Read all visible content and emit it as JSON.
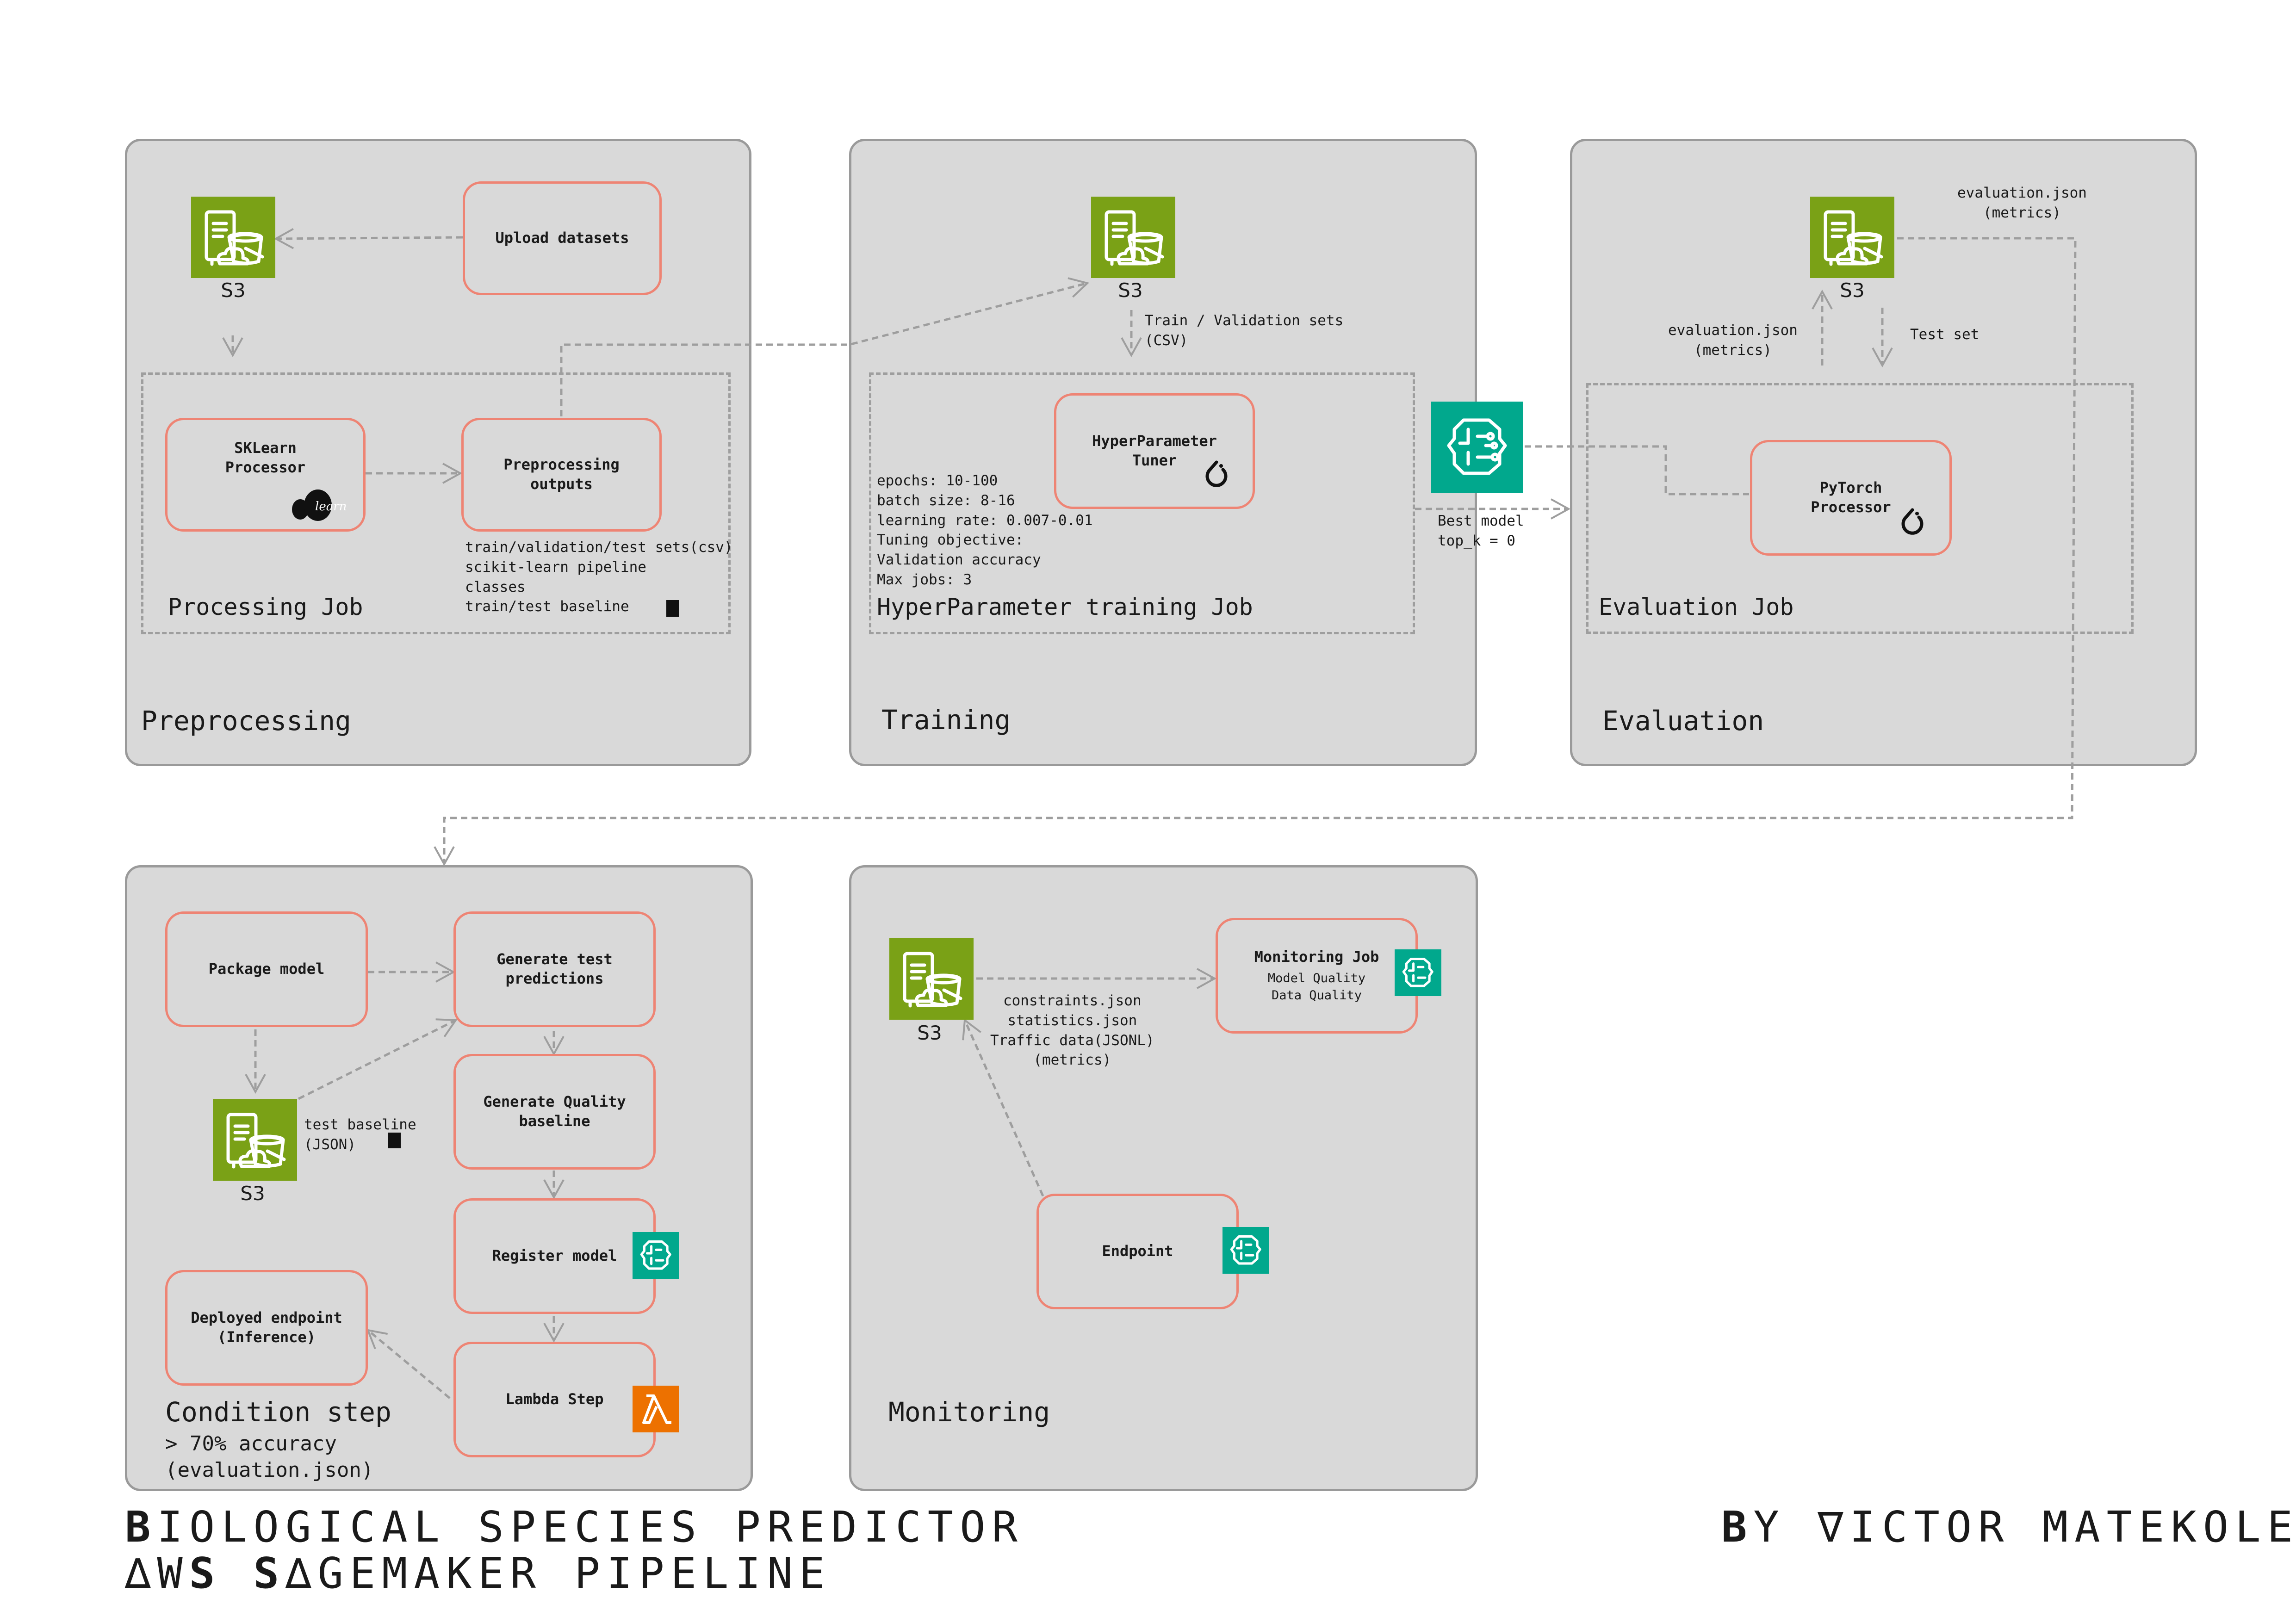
{
  "panels": {
    "preprocessing": {
      "title": "Preprocessing",
      "job_title": "Processing Job",
      "upload_datasets": "Upload datasets",
      "s3_label": "S3",
      "sklearn_processor": "SKLearn\nProcessor",
      "sklearn_logo_text": "learn",
      "preprocessing_outputs": "Preprocessing\noutputs",
      "outputs_list": "train/validation/test sets(csv)\nscikit-learn pipeline\nclasses\ntrain/test baseline"
    },
    "training": {
      "title": "Training",
      "job_title": "HyperParameter training Job",
      "s3_label": "S3",
      "s3_to_tuner_label": "Train / Validation sets\n(CSV)",
      "tuner": "HyperParameter\nTuner",
      "hyperparameters": "epochs: 10-100\nbatch size: 8-16\nlearning rate: 0.007-0.01\nTuning objective:\nValidation accuracy\nMax jobs: 3",
      "best_model_label": "Best model\ntop_k = 0"
    },
    "evaluation": {
      "title": "Evaluation",
      "job_title": "Evaluation Job",
      "s3_label": "S3",
      "metrics_out_label": "evaluation.json\n(metrics)",
      "metrics_up_label": "evaluation.json\n(metrics)",
      "test_set_label": "Test set",
      "pytorch_processor": "PyTorch\nProcessor"
    },
    "condition": {
      "title": "Condition step",
      "subtitle": "> 70% accuracy\n(evaluation.json)",
      "package_model": "Package model",
      "generate_predictions": "Generate test\npredictions",
      "generate_quality_baseline": "Generate Quality\nbaseline",
      "register_model": "Register model",
      "lambda_step": "Lambda Step",
      "deployed_endpoint": "Deployed endpoint\n(Inference)",
      "s3_label": "S3",
      "test_baseline_label": "test baseline\n(JSON)"
    },
    "monitoring": {
      "title": "Monitoring",
      "s3_label": "S3",
      "monitoring_job": "Monitoring Job",
      "monitoring_job_sub": "Model Quality\nData Quality",
      "endpoint": "Endpoint",
      "s3_to_job_label": "constraints.json\nstatistics.json\nTraffic data(JSONL)\n(metrics)"
    }
  },
  "footer": {
    "title_line1_first": "B",
    "title_line1_rest": "IOLOGICAL SPECIES PREDICTOR",
    "title_line2_a": "∆W",
    "title_line2_b": "S",
    "title_line2_c": " ",
    "title_line2_d": "S",
    "title_line2_e": "∆GEMAKER PIPELINE",
    "author_first": "B",
    "author_rest": "Y ∇ICTOR MATEKOLE"
  },
  "colors": {
    "panel_bg": "#d9d9d9",
    "panel_border": "#9a9a9a",
    "step_border": "#ee8474",
    "s3_green": "#7aa116",
    "sagemaker_teal": "#01a88d",
    "lambda_orange": "#ed7100",
    "connector": "#9e9e9e"
  },
  "icons": {
    "s3": "s3-bucket-icon",
    "sagemaker": "sagemaker-brain-icon",
    "lambda": "lambda-icon",
    "pytorch": "pytorch-flame-icon",
    "sklearn": "scikit-learn-logo",
    "notebook": "document-icon"
  }
}
